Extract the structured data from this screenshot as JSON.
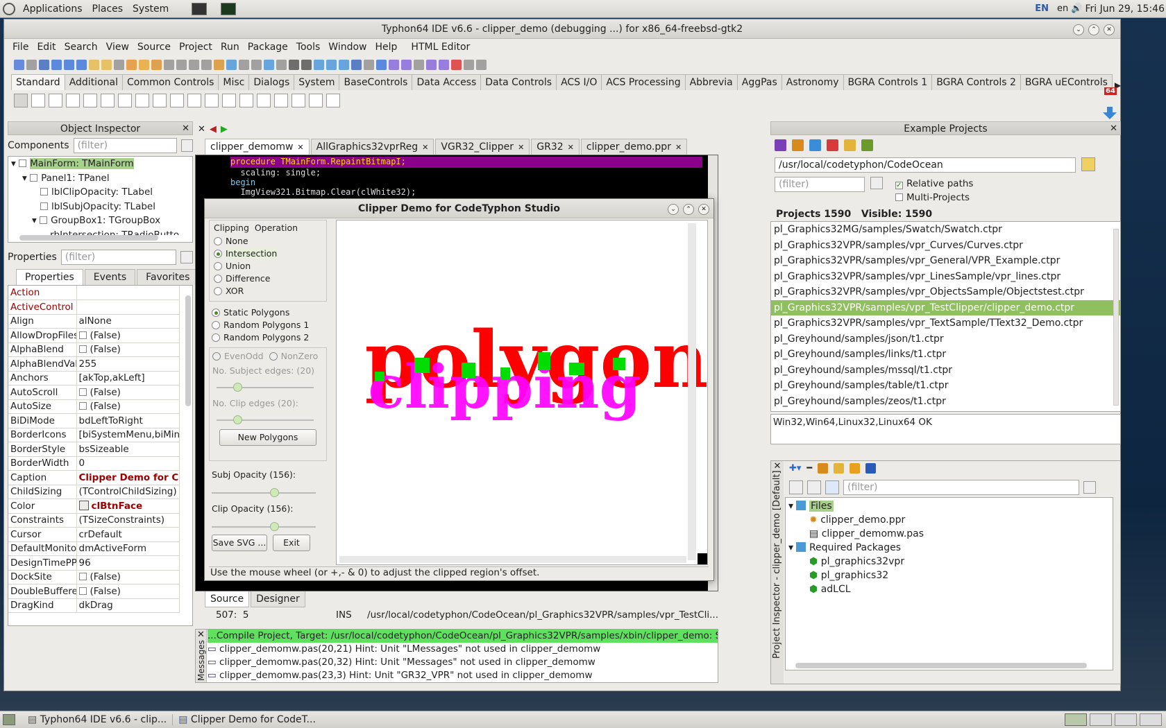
{
  "desktop": {
    "menu": [
      "Applications",
      "Places",
      "System"
    ],
    "lang": "EN",
    "locale": "en",
    "clock": "Fri Jun 29, 15:46"
  },
  "ide": {
    "title": "Typhon64 IDE v6.6 - clipper_demo (debugging ...) for x86_64-freebsd-gtk2",
    "menu": [
      "File",
      "Edit",
      "Search",
      "View",
      "Source",
      "Project",
      "Run",
      "Package",
      "Tools",
      "Window",
      "Help",
      "HTML Editor"
    ],
    "palette_tabs": [
      "Standard",
      "Additional",
      "Common Controls",
      "Misc",
      "Dialogs",
      "System",
      "BaseControls",
      "Data Access",
      "Data Controls",
      "ACS I/O",
      "ACS Processing",
      "Abbrevia",
      "AggPas",
      "Astronomy",
      "BGRA Controls 1",
      "BGRA Controls 2",
      "BGRA uEControls"
    ],
    "bits": "64"
  },
  "oi": {
    "title": "Object Inspector",
    "components_label": "Components",
    "filter": "(filter)",
    "tree": [
      "MainForm: TMainForm",
      "Panel1: TPanel",
      "lblClipOpacity: TLabel",
      "lblSubjOpacity: TLabel",
      "GroupBox1: TGroupBox",
      "rbIntersection: TRadioButto"
    ],
    "properties_label": "Properties",
    "tabs": [
      "Properties",
      "Events",
      "Favorites"
    ],
    "props": [
      [
        "Action",
        ""
      ],
      [
        "ActiveControl",
        ""
      ],
      [
        "Align",
        "alNone"
      ],
      [
        "AllowDropFiles",
        "(False)"
      ],
      [
        "AlphaBlend",
        "(False)"
      ],
      [
        "AlphaBlendVal",
        "255"
      ],
      [
        "Anchors",
        "[akTop,akLeft]"
      ],
      [
        "AutoScroll",
        "(False)"
      ],
      [
        "AutoSize",
        "(False)"
      ],
      [
        "BiDiMode",
        "bdLeftToRight"
      ],
      [
        "BorderIcons",
        "[biSystemMenu,biMini"
      ],
      [
        "BorderStyle",
        "bsSizeable"
      ],
      [
        "BorderWidth",
        "0"
      ],
      [
        "Caption",
        "Clipper Demo for C"
      ],
      [
        "ChildSizing",
        "(TControlChildSizing)"
      ],
      [
        "Color",
        "clBtnFace"
      ],
      [
        "Constraints",
        "(TSizeConstraints)"
      ],
      [
        "Cursor",
        "crDefault"
      ],
      [
        "DefaultMonito",
        "dmActiveForm"
      ],
      [
        "DesignTimePP",
        "96"
      ],
      [
        "DockSite",
        "(False)"
      ],
      [
        "DoubleBuffere",
        "(False)"
      ],
      [
        "DragKind",
        "dkDrag"
      ]
    ]
  },
  "editor": {
    "tabs": [
      "clipper_demomw",
      "AllGraphics32vprReg",
      "VGR32_Clipper",
      "GR32",
      "clipper_demo.ppr"
    ],
    "code": [
      "procedure TMainForm.RepaintBitmapI;",
      "  scaling: single;",
      "begin",
      "  ImgView321.Bitmap.Clear(clWhite32);"
    ],
    "bottom_tabs": [
      "Source",
      "Designer"
    ],
    "status": {
      "pos": "507:  5",
      "mode": "INS",
      "file": "/usr/local/codetyphon/CodeOcean/pl_Graphics32VPR/samples/vpr_TestCli..."
    }
  },
  "messages": {
    "label": "Messages",
    "lines": [
      "...Compile Project, Target: /usr/local/codetyphon/CodeOcean/pl_Graphics32VPR/samples/xbin/clipper_demo: Success, Wa",
      "clipper_demomw.pas(20,21) Hint: Unit \"LMessages\" not used in clipper_demomw",
      "clipper_demomw.pas(20,32) Hint: Unit \"Messages\" not used in clipper_demomw",
      "clipper_demomw.pas(23,3) Hint: Unit \"GR32_VPR\" not used in clipper_demomw"
    ]
  },
  "demo": {
    "title": "Clipper Demo for CodeTyphon Studio",
    "group": "Clipping  Operation",
    "ops": [
      "None",
      "Intersection",
      "Union",
      "Difference",
      "XOR"
    ],
    "poly": [
      "Static Polygons",
      "Random Polygons 1",
      "Random Polygons 2"
    ],
    "fill": [
      "EvenOdd",
      "NonZero"
    ],
    "subj_edges": "No. Subject edges: (20)",
    "clip_edges": "No. Clip edges (20):",
    "new_btn": "New Polygons",
    "subj_op": "Subj Opacity (156):",
    "clip_op": "Clip Opacity (156):",
    "save_btn": "Save SVG ...",
    "exit_btn": "Exit",
    "word1": "polygon",
    "word2": "clipping",
    "status": "Use the mouse wheel (or +,- & 0) to adjust the clipped region's offset.",
    "colors": {
      "red": "#ff0000",
      "magenta": "#ff00ff",
      "green": "#00dd00"
    }
  },
  "examples": {
    "title": "Example Projects",
    "path": "/usr/local/codetyphon/CodeOcean",
    "filter": "(filter)",
    "relative": "Relative paths",
    "multi": "Multi-Projects",
    "count": "Projects 1590   Visible: 1590",
    "items": [
      "pl_Graphics32MG/samples/Swatch/Swatch.ctpr",
      "pl_Graphics32VPR/samples/vpr_Curves/Curves.ctpr",
      "pl_Graphics32VPR/samples/vpr_General/VPR_Example.ctpr",
      "pl_Graphics32VPR/samples/vpr_LinesSample/vpr_lines.ctpr",
      "pl_Graphics32VPR/samples/vpr_ObjectsSample/Objectstest.ctpr",
      "pl_Graphics32VPR/samples/vpr_TestClipper/clipper_demo.ctpr",
      "pl_Graphics32VPR/samples/vpr_TextSample/TText32_Demo.ctpr",
      "pl_Greyhound/samples/json/t1.ctpr",
      "pl_Greyhound/samples/links/t1.ctpr",
      "pl_Greyhound/samples/mssql/t1.ctpr",
      "pl_Greyhound/samples/table/t1.ctpr",
      "pl_Greyhound/samples/zeos/t1.ctpr"
    ],
    "selected": 5,
    "info": "Win32,Win64,Linux32,Linux64 OK"
  },
  "pi": {
    "vertical": "Project Inspector - clipper_demo [Default]",
    "filter": "(filter)",
    "files": "Files",
    "file_items": [
      "clipper_demo.ppr",
      "clipper_demomw.pas"
    ],
    "req": "Required Packages",
    "pkgs": [
      "pl_graphics32vpr",
      "pl_graphics32",
      "adLCL"
    ]
  },
  "taskbar": {
    "items": [
      "Typhon64 IDE v6.6 - clip...",
      "Clipper Demo for CodeT..."
    ]
  }
}
